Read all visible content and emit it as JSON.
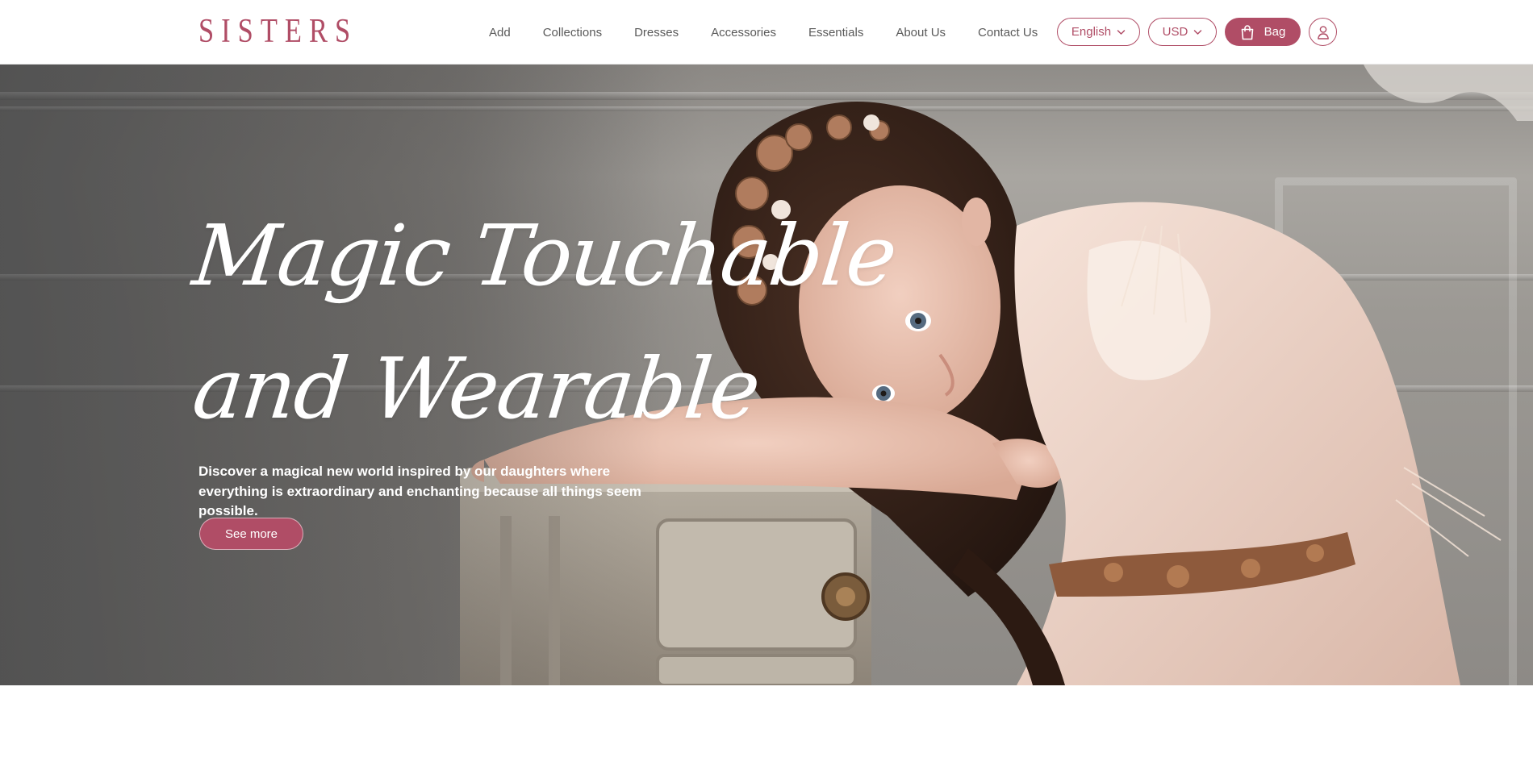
{
  "header": {
    "logo": "SISTERS",
    "nav": [
      "Add",
      "Collections",
      "Dresses",
      "Accessories",
      "Essentials",
      "About Us",
      "Contact Us"
    ],
    "language": "English",
    "currency": "USD",
    "bag_label": "Bag"
  },
  "hero": {
    "headline_line1": "Magic Touchable",
    "headline_line2": "and Wearable",
    "description": "Discover a magical new world inspired by our daughters where everything is extraordinary and enchanting because all things seem possible.",
    "cta_label": "See more"
  },
  "colors": {
    "brand": "#b04d66",
    "text": "#5a5a5a"
  },
  "icons": [
    "chevron-down-icon",
    "shopping-bag-icon",
    "user-icon"
  ]
}
